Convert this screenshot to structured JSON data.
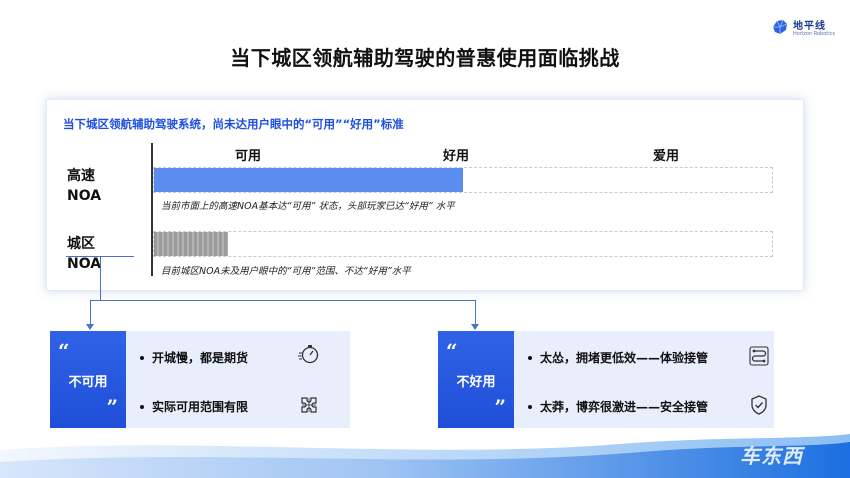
{
  "logo": {
    "cn": "地平线",
    "en": "Horizon Robotics",
    "icon": "horizon-logo-mark"
  },
  "title": "当下城区领航辅助驾驶的普惠使用面临挑战",
  "panel": {
    "heading": "当下城区领航辅助驾驶系统，尚未达用户眼中的“可用”“好用”标准",
    "levels": [
      "可用",
      "好用",
      "爱用"
    ],
    "rows": [
      {
        "label_line1": "高速",
        "label_line2": "NOA",
        "progress_fraction": 0.5,
        "note": "当前市面上的高速NOA基本达“可用” 状态，头部玩家已达“好用” 水平"
      },
      {
        "label_line1": "城区",
        "label_line2": "NOA",
        "progress_fraction": 0.12,
        "note": "目前城区NOA未及用户眼中的“可用”范围、不达“好用”水平"
      }
    ]
  },
  "cards": [
    {
      "tag": "不可用",
      "quote_open": "“",
      "quote_close": "”",
      "items": [
        {
          "text": "开城慢，都是期货",
          "icon": "stopwatch-icon"
        },
        {
          "text": "实际可用范围有限",
          "icon": "puzzle-icon"
        }
      ]
    },
    {
      "tag": "不好用",
      "quote_open": "“",
      "quote_close": "”",
      "items": [
        {
          "text": "太怂，拥堵更低效——体验接管",
          "icon": "route-icon"
        },
        {
          "text": "太莽，博弈很激进——安全接管",
          "icon": "shield-check-icon"
        }
      ]
    }
  ],
  "watermark": "车东西",
  "colors": {
    "accent": "#1f4fe0",
    "highway_bar": "#5b8def",
    "city_bar": "#a6a6a6",
    "card_bg": "#e8eefb",
    "card_tag": "#2f63e6"
  }
}
